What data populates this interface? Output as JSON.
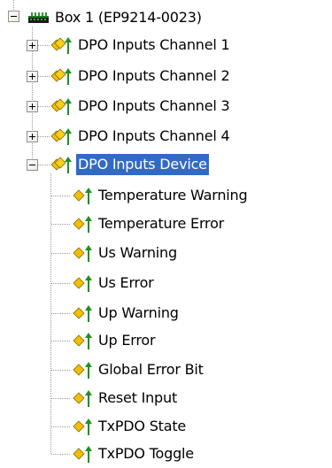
{
  "tree": {
    "root": {
      "label": "Box 1 (EP9214-0023)",
      "icon": "box-module-icon",
      "expanded": true
    },
    "channels": [
      {
        "label": "DPO Inputs Channel 1",
        "icon": "input-group-icon",
        "expanded": false
      },
      {
        "label": "DPO Inputs Channel 2",
        "icon": "input-group-icon",
        "expanded": false
      },
      {
        "label": "DPO Inputs Channel 3",
        "icon": "input-group-icon",
        "expanded": false
      },
      {
        "label": "DPO Inputs Channel 4",
        "icon": "input-group-icon",
        "expanded": false
      }
    ],
    "device": {
      "label": "DPO Inputs Device",
      "icon": "input-group-icon",
      "expanded": true,
      "selected": true
    },
    "device_items": [
      {
        "label": "Temperature Warning",
        "icon": "input-variable-icon"
      },
      {
        "label": "Temperature Error",
        "icon": "input-variable-icon"
      },
      {
        "label": "Us Warning",
        "icon": "input-variable-icon"
      },
      {
        "label": "Us Error",
        "icon": "input-variable-icon"
      },
      {
        "label": "Up Warning",
        "icon": "input-variable-icon"
      },
      {
        "label": "Up Error",
        "icon": "input-variable-icon"
      },
      {
        "label": "Global Error Bit",
        "icon": "input-variable-icon"
      },
      {
        "label": "Reset Input",
        "icon": "input-variable-icon"
      },
      {
        "label": "TxPDO State",
        "icon": "input-variable-icon"
      },
      {
        "label": "TxPDO Toggle",
        "icon": "input-variable-icon"
      }
    ]
  },
  "colors": {
    "selection_background": "#316ac5",
    "selection_text": "#ffffff",
    "tree_lines": "#9a9a9a",
    "group_icon_yellow": "#f0c000",
    "variable_icon_yellow": "#f0c000",
    "arrow_green": "#1f8f1f"
  }
}
